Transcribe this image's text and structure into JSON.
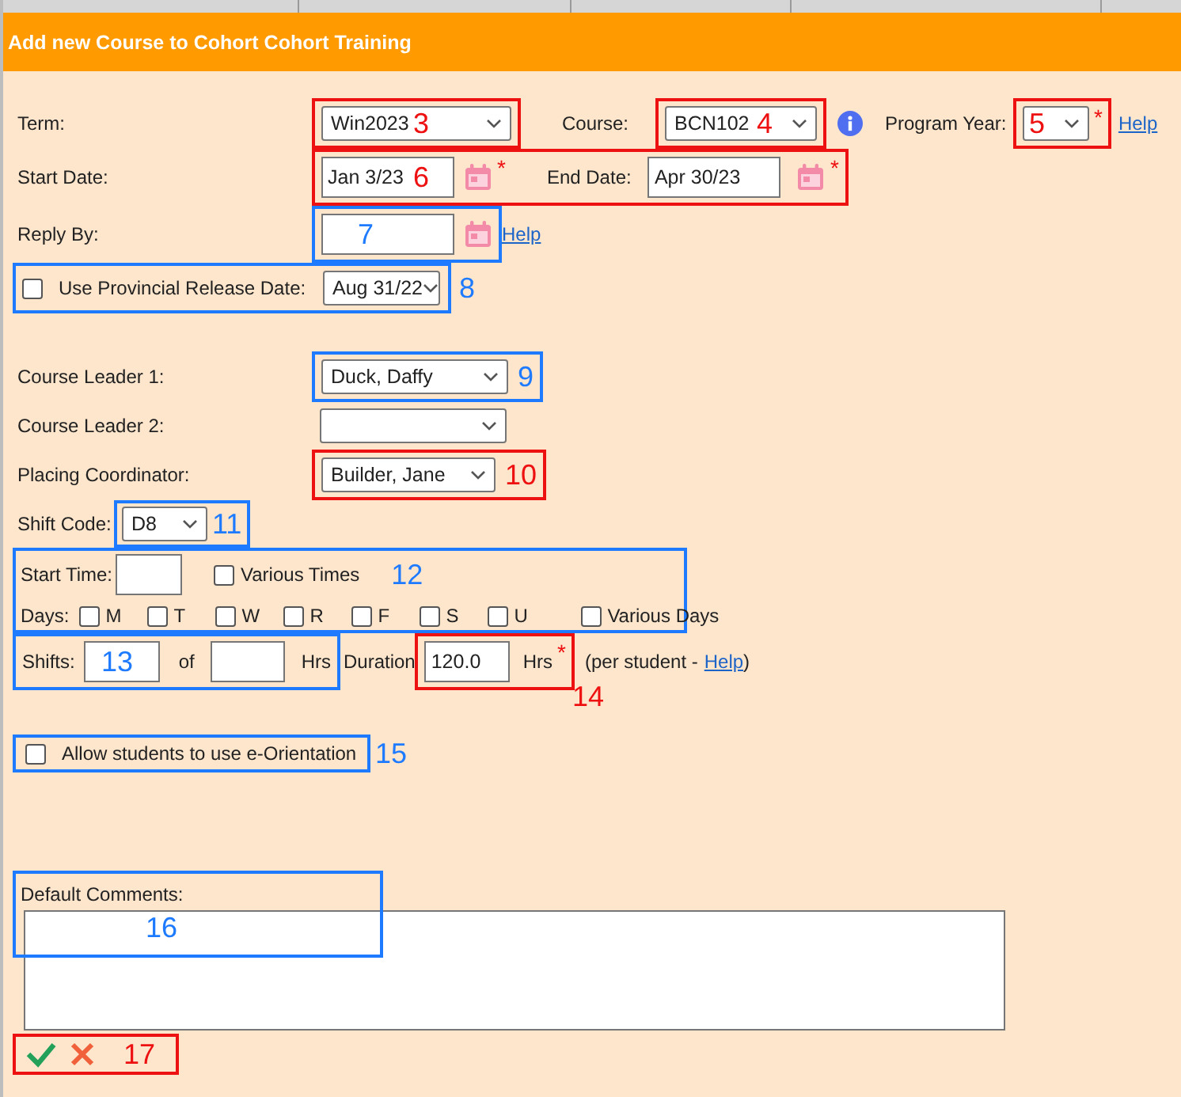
{
  "header": {
    "title": "Add new Course to Cohort Cohort Training"
  },
  "term": {
    "label": "Term:",
    "value": "Win2023",
    "callout": {
      "number": "3",
      "color": "#ee1111"
    }
  },
  "course": {
    "label": "Course:",
    "value": "BCN102",
    "callout": {
      "number": "4",
      "color": "#ee1111"
    }
  },
  "program_year": {
    "label": "Program Year:",
    "required_mark": "*",
    "help": "Help",
    "callout": {
      "number": "5",
      "color": "#ee1111"
    }
  },
  "dates": {
    "callout": {
      "number": "6",
      "color": "#ee1111"
    },
    "start": {
      "label": "Start Date:",
      "value": "Jan 3/23",
      "required_mark": "*"
    },
    "end": {
      "label": "End Date:",
      "value": "Apr 30/23",
      "required_mark": "*"
    }
  },
  "reply_by": {
    "label": "Reply By:",
    "help": "Help",
    "callout": {
      "number": "7",
      "color": "#1e7bff"
    }
  },
  "provincial_release": {
    "label": "Use Provincial Release Date:",
    "checked": false,
    "value": "Aug 31/22",
    "callout": {
      "number": "8",
      "color": "#1e7bff"
    }
  },
  "course_leader_1": {
    "label": "Course Leader 1:",
    "value": "Duck, Daffy",
    "callout": {
      "number": "9",
      "color": "#1e7bff"
    }
  },
  "course_leader_2": {
    "label": "Course Leader 2:"
  },
  "placing_coordinator": {
    "label": "Placing Coordinator:",
    "value": "Builder, Jane",
    "callout": {
      "number": "10",
      "color": "#ee1111"
    }
  },
  "shift_code": {
    "label": "Shift Code:",
    "value": "D8",
    "callout": {
      "number": "11",
      "color": "#1e7bff"
    }
  },
  "schedule": {
    "callout": {
      "number": "12",
      "color": "#1e7bff"
    },
    "start_time_label": "Start Time:",
    "various_times": {
      "label": "Various Times",
      "checked": false
    },
    "days_label": "Days:",
    "days": [
      {
        "label": "M",
        "checked": false
      },
      {
        "label": "T",
        "checked": false
      },
      {
        "label": "W",
        "checked": false
      },
      {
        "label": "R",
        "checked": false
      },
      {
        "label": "F",
        "checked": false
      },
      {
        "label": "S",
        "checked": false
      },
      {
        "label": "U",
        "checked": false
      }
    ],
    "various_days": {
      "label": "Various Days",
      "checked": false
    }
  },
  "shifts": {
    "label": "Shifts:",
    "of_label": "of",
    "unit": "Hrs",
    "callout": {
      "number": "13",
      "color": "#1e7bff"
    }
  },
  "duration": {
    "label": "Duration",
    "value": "120.0",
    "unit": "Hrs",
    "required_mark": "*",
    "note_prefix": "(per student -",
    "help": "Help",
    "note_suffix": ")",
    "callout": {
      "number": "14",
      "color": "#ee1111"
    }
  },
  "e_orientation": {
    "label": "Allow students to use e-Orientation",
    "checked": false,
    "callout": {
      "number": "15",
      "color": "#1e7bff"
    }
  },
  "comments": {
    "label": "Default Comments:",
    "callout": {
      "number": "16",
      "color": "#1e7bff"
    }
  },
  "actions": {
    "callout": {
      "number": "17",
      "color": "#ee1111"
    }
  }
}
